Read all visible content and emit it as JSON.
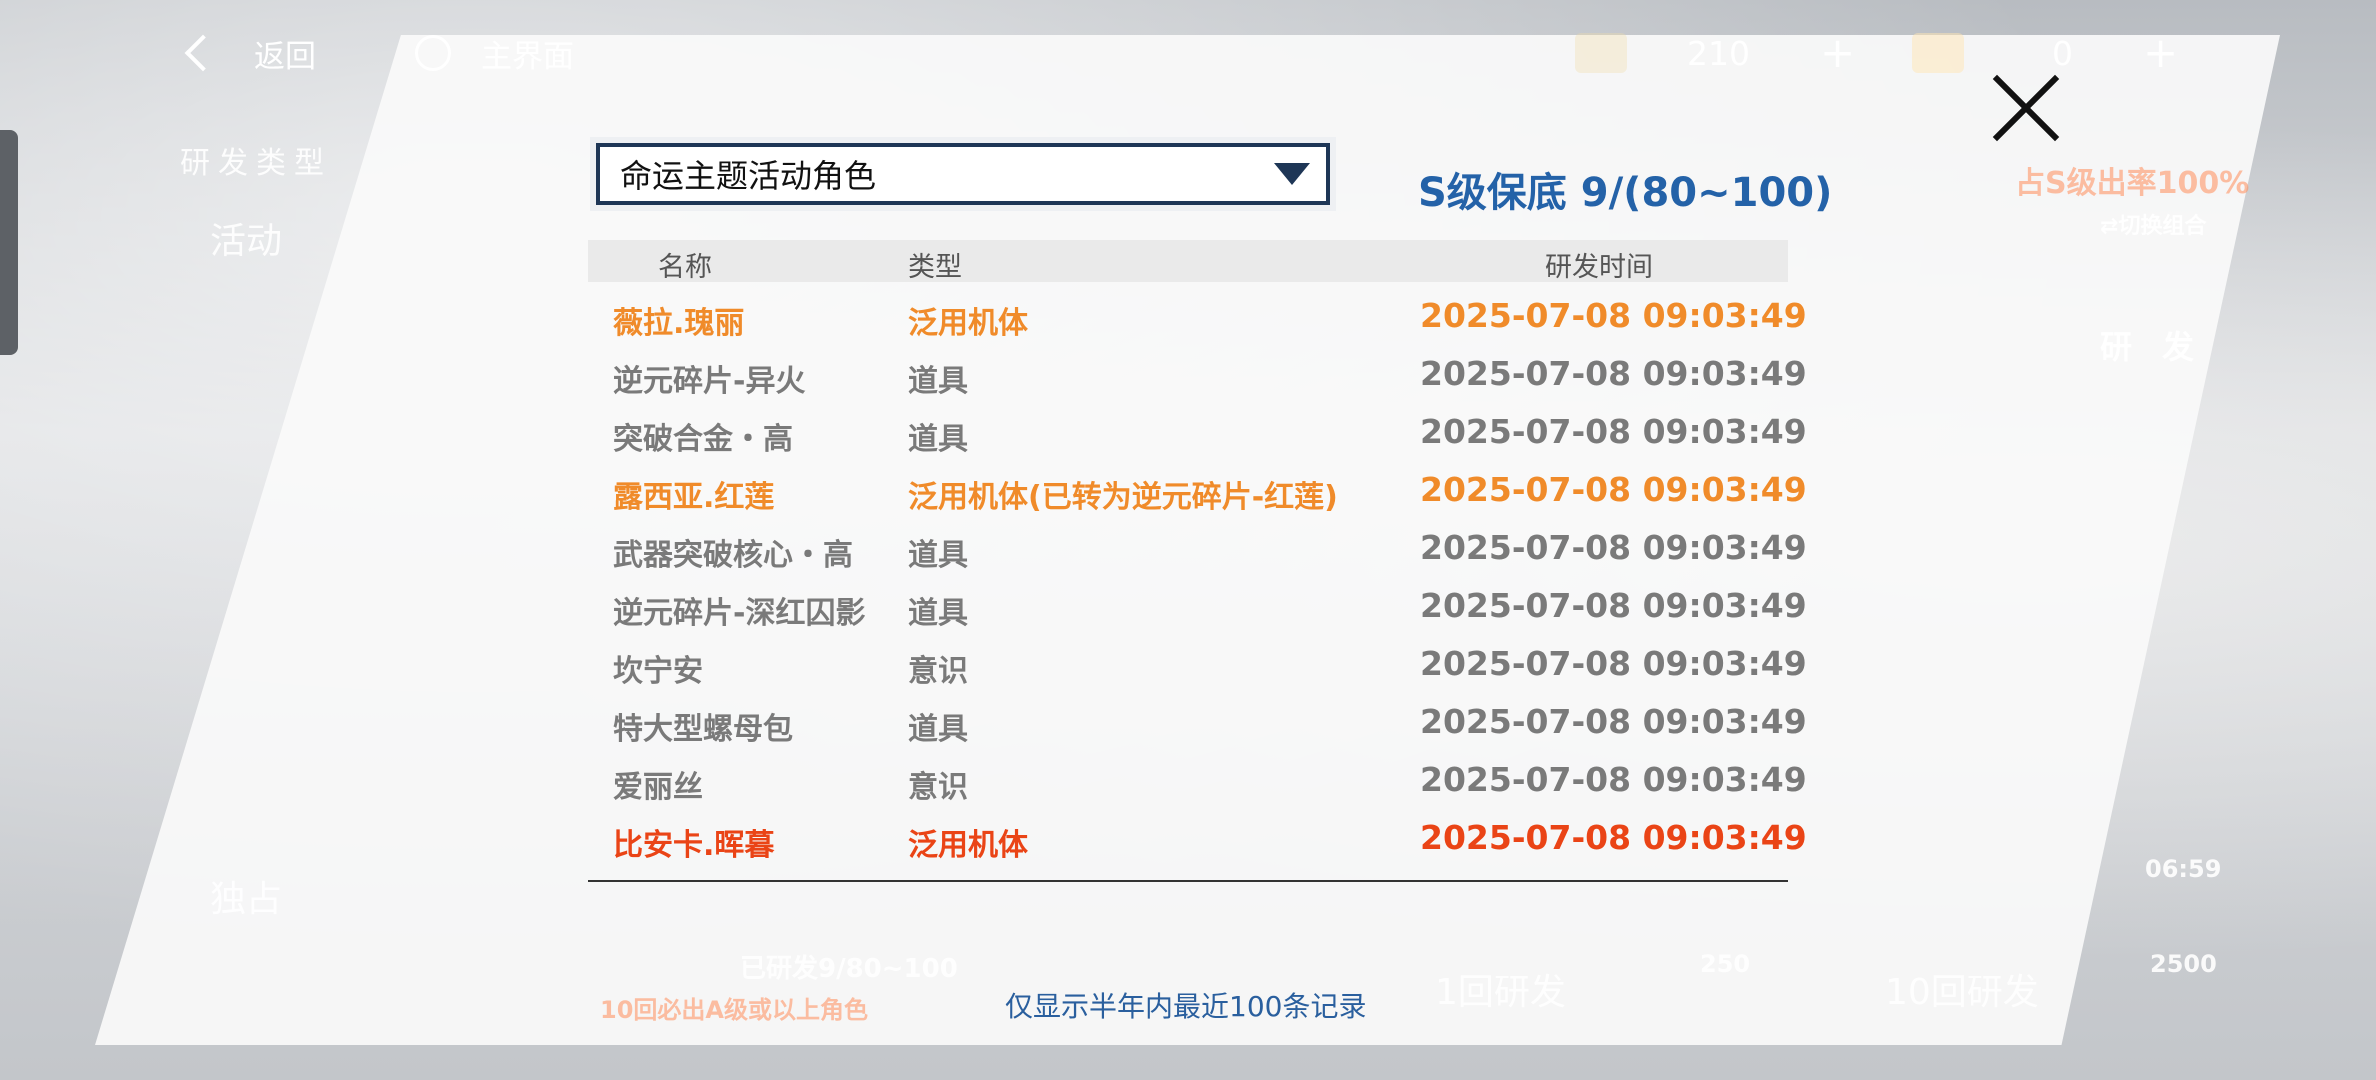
{
  "topbar": {
    "back_label": "返回",
    "home_label": "主界面",
    "currency1_value": "210",
    "currency2_value": "0",
    "plus_symbol": "+"
  },
  "background_ui": {
    "research_type_label": "研发类型",
    "left_card_title": "活动",
    "bottom_card_title": "独占",
    "s_rate_label": "占S级出率100%",
    "switch_combo_label": "切换组合",
    "research_label": "研发",
    "pity_summary": "已研发9/80~100",
    "ten_guarantee": "10回必出A级或以上角色",
    "one_pull_label": "1回研发",
    "one_pull_cost": "250",
    "ten_pull_label": "10回研发",
    "ten_pull_cost": "2500",
    "time_label": "06:59"
  },
  "dialog": {
    "pool_select_value": "命运主题活动角色",
    "pity_text": "S级保底 9/(80~100)",
    "headers": {
      "name": "名称",
      "type": "类型",
      "time": "研发时间"
    },
    "records": [
      {
        "name": "薇拉.瑰丽",
        "type": "泛用机体",
        "time": "2025-07-08 09:03:49",
        "rarity": "orange"
      },
      {
        "name": "逆元碎片-异火",
        "type": "道具",
        "time": "2025-07-08 09:03:49",
        "rarity": "gray"
      },
      {
        "name": "突破合金・高",
        "type": "道具",
        "time": "2025-07-08 09:03:49",
        "rarity": "gray"
      },
      {
        "name": "露西亚.红莲",
        "type": "泛用机体(已转为逆元碎片-红莲)",
        "time": "2025-07-08 09:03:49",
        "rarity": "orange"
      },
      {
        "name": "武器突破核心・高",
        "type": "道具",
        "time": "2025-07-08 09:03:49",
        "rarity": "gray"
      },
      {
        "name": "逆元碎片-深红囚影",
        "type": "道具",
        "time": "2025-07-08 09:03:49",
        "rarity": "gray"
      },
      {
        "name": "坎宁安",
        "type": "意识",
        "time": "2025-07-08 09:03:49",
        "rarity": "gray"
      },
      {
        "name": "特大型螺母包",
        "type": "道具",
        "time": "2025-07-08 09:03:49",
        "rarity": "gray"
      },
      {
        "name": "爱丽丝",
        "type": "意识",
        "time": "2025-07-08 09:03:49",
        "rarity": "gray"
      },
      {
        "name": "比安卡.晖暮",
        "type": "泛用机体",
        "time": "2025-07-08 09:03:49",
        "rarity": "red"
      }
    ],
    "footnote": "仅显示半年内最近100条记录"
  },
  "colors": {
    "orange_rarity": "#f08b2a",
    "red_rarity": "#ea4416",
    "gray_rarity": "#7a7a7a",
    "accent_blue": "#2462a8"
  }
}
